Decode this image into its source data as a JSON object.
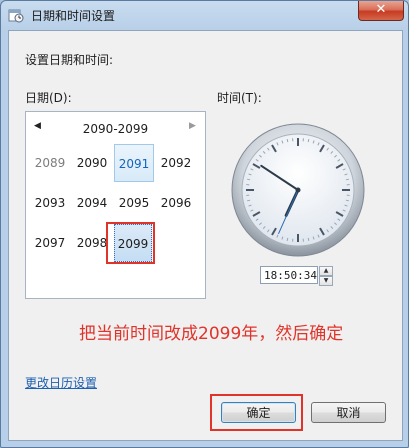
{
  "window": {
    "title": "日期和时间设置",
    "close_glyph": "✕"
  },
  "intro": "设置日期和时间:",
  "date": {
    "label": "日期(D):",
    "nav_prev": "◀",
    "nav_next": "▶",
    "range": "2090-2099",
    "years": [
      [
        "2089",
        "2090",
        "2091",
        "2092"
      ],
      [
        "2093",
        "2094",
        "2095",
        "2096"
      ],
      [
        "2097",
        "2098",
        "2099"
      ]
    ],
    "selected_year": "2091",
    "focused_year": "2099"
  },
  "time": {
    "label": "时间(T):",
    "value": "18:50:34",
    "clock": {
      "hour": 18,
      "minute": 50,
      "second": 34
    }
  },
  "annotation": "把当前时间改成2099年，然后确定",
  "link": "更改日历设置",
  "buttons": {
    "ok": "确定",
    "cancel": "取消"
  },
  "colors": {
    "annotation": "#e0342a",
    "link": "#1e5fb0",
    "selected": "#1565b8"
  }
}
